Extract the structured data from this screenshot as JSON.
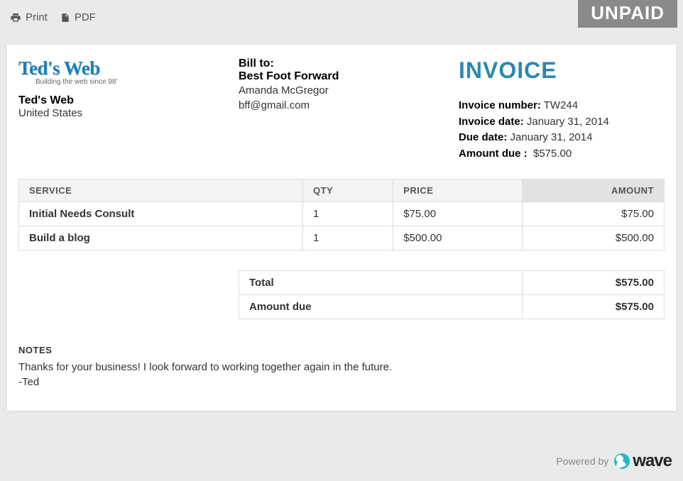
{
  "status": "UNPAID",
  "actions": {
    "print": "Print",
    "pdf": "PDF"
  },
  "company": {
    "brand": "Ted's Web",
    "tagline": "Building the web since 98'",
    "name": "Ted's Web",
    "country": "United States"
  },
  "billTo": {
    "label": "Bill to:",
    "name": "Best Foot Forward",
    "contact": "Amanda McGregor",
    "email": "bff@gmail.com"
  },
  "invoice": {
    "title": "INVOICE",
    "numberLabel": "Invoice number:",
    "number": "TW244",
    "dateLabel": "Invoice date:",
    "date": "January 31, 2014",
    "dueLabel": "Due date:",
    "due": "January 31, 2014",
    "amountDueLabel": "Amount due :",
    "amountDue": "$575.00"
  },
  "columns": {
    "service": "SERVICE",
    "qty": "QTY",
    "price": "PRICE",
    "amount": "AMOUNT"
  },
  "items": [
    {
      "service": "Initial Needs Consult",
      "qty": "1",
      "price": "$75.00",
      "amount": "$75.00"
    },
    {
      "service": "Build a blog",
      "qty": "1",
      "price": "$500.00",
      "amount": "$500.00"
    }
  ],
  "totals": {
    "totalLabel": "Total",
    "totalValue": "$575.00",
    "dueLabel": "Amount due",
    "dueValue": "$575.00"
  },
  "notes": {
    "heading": "NOTES",
    "body": "Thanks for your business! I look forward to working together again in the future.\n-Ted"
  },
  "footer": {
    "poweredBy": "Powered by",
    "brand": "wave"
  }
}
